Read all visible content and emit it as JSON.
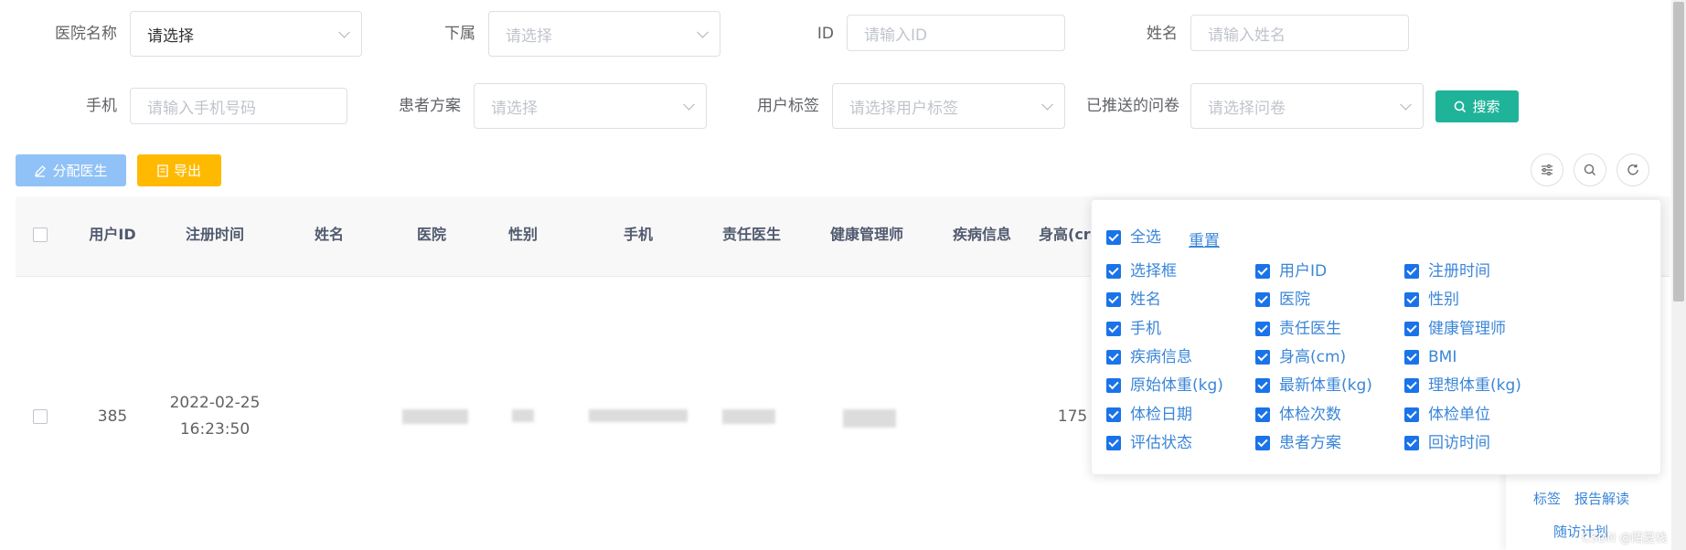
{
  "filters": {
    "row1": [
      {
        "label": "医院名称",
        "kind": "select",
        "value": "请选择",
        "filled": true
      },
      {
        "label": "下属",
        "kind": "select",
        "value": "请选择"
      },
      {
        "label": "ID",
        "kind": "input",
        "placeholder": "请输入ID"
      },
      {
        "label": "姓名",
        "kind": "input",
        "placeholder": "请输入姓名"
      }
    ],
    "row2": [
      {
        "label": "手机",
        "kind": "input",
        "placeholder": "请输入手机号码"
      },
      {
        "label": "患者方案",
        "kind": "select",
        "value": "请选择"
      },
      {
        "label": "用户标签",
        "kind": "select",
        "value": "请选择用户标签"
      },
      {
        "label": "已推送的问卷",
        "kind": "select",
        "value": "请选择问卷"
      }
    ],
    "search_label": "搜索"
  },
  "toolbar": {
    "assign_label": "分配医生",
    "export_label": "导出",
    "assign_color": "#90c2f7",
    "export_color": "#ffba00",
    "search_color": "#1fb39a"
  },
  "table": {
    "headers": [
      "用户ID",
      "注册时间",
      "姓名",
      "医院",
      "性别",
      "手机",
      "责任医生",
      "健康管理师",
      "疾病信息",
      "身高(cr"
    ],
    "row": {
      "user_id": "385",
      "reg_date": "2022-02-25",
      "reg_time": "16:23:50",
      "height": "175"
    }
  },
  "column_panel": {
    "select_all": "全选",
    "reset": "重置",
    "options": [
      "选择框",
      "用户ID",
      "注册时间",
      "姓名",
      "医院",
      "性别",
      "手机",
      "责任医生",
      "健康管理师",
      "疾病信息",
      "身高(cm)",
      "BMI",
      "原始体重(kg)",
      "最新体重(kg)",
      "理想体重(kg)",
      "体检日期",
      "体检次数",
      "体检单位",
      "评估状态",
      "患者方案",
      "回访时间"
    ]
  },
  "actions": {
    "tag": "标签",
    "report": "报告解读",
    "followup": "随访计划"
  },
  "watermark": "CSDN @陌夏栈"
}
